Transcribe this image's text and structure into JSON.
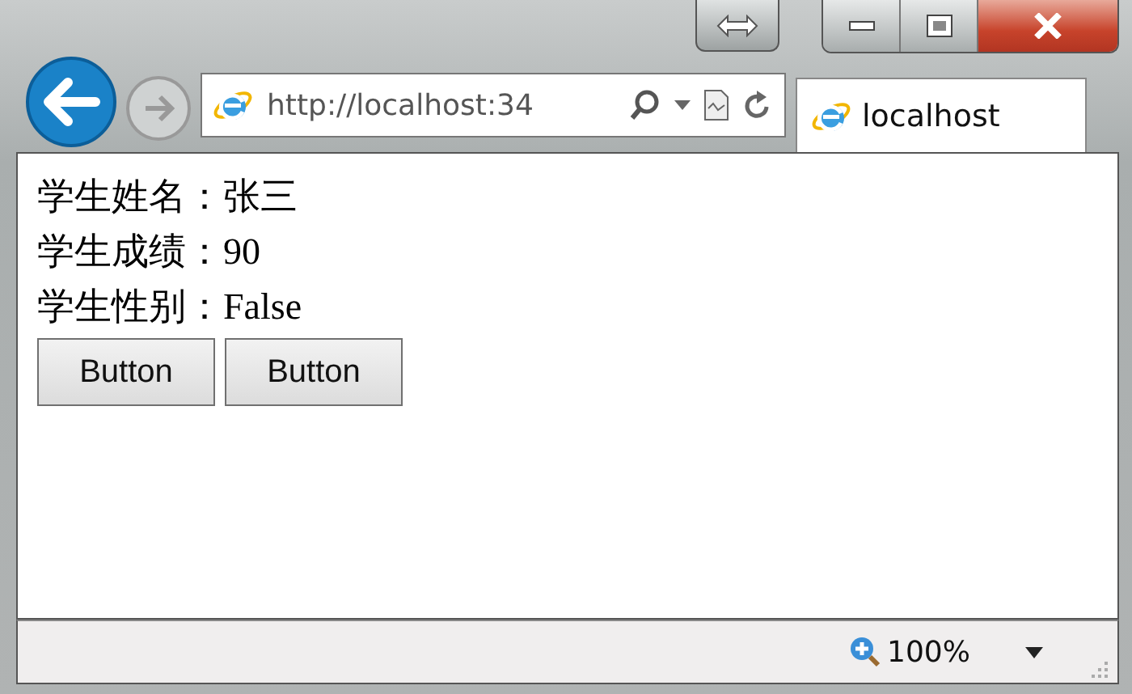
{
  "address_bar": {
    "value": "http://localhost:34"
  },
  "tab": {
    "label": "localhost"
  },
  "content": {
    "lines": [
      "学生姓名：张三",
      "学生成绩：90",
      "学生性别：False"
    ],
    "buttons": [
      "Button",
      "Button"
    ]
  },
  "status_bar": {
    "zoom": "100%"
  }
}
